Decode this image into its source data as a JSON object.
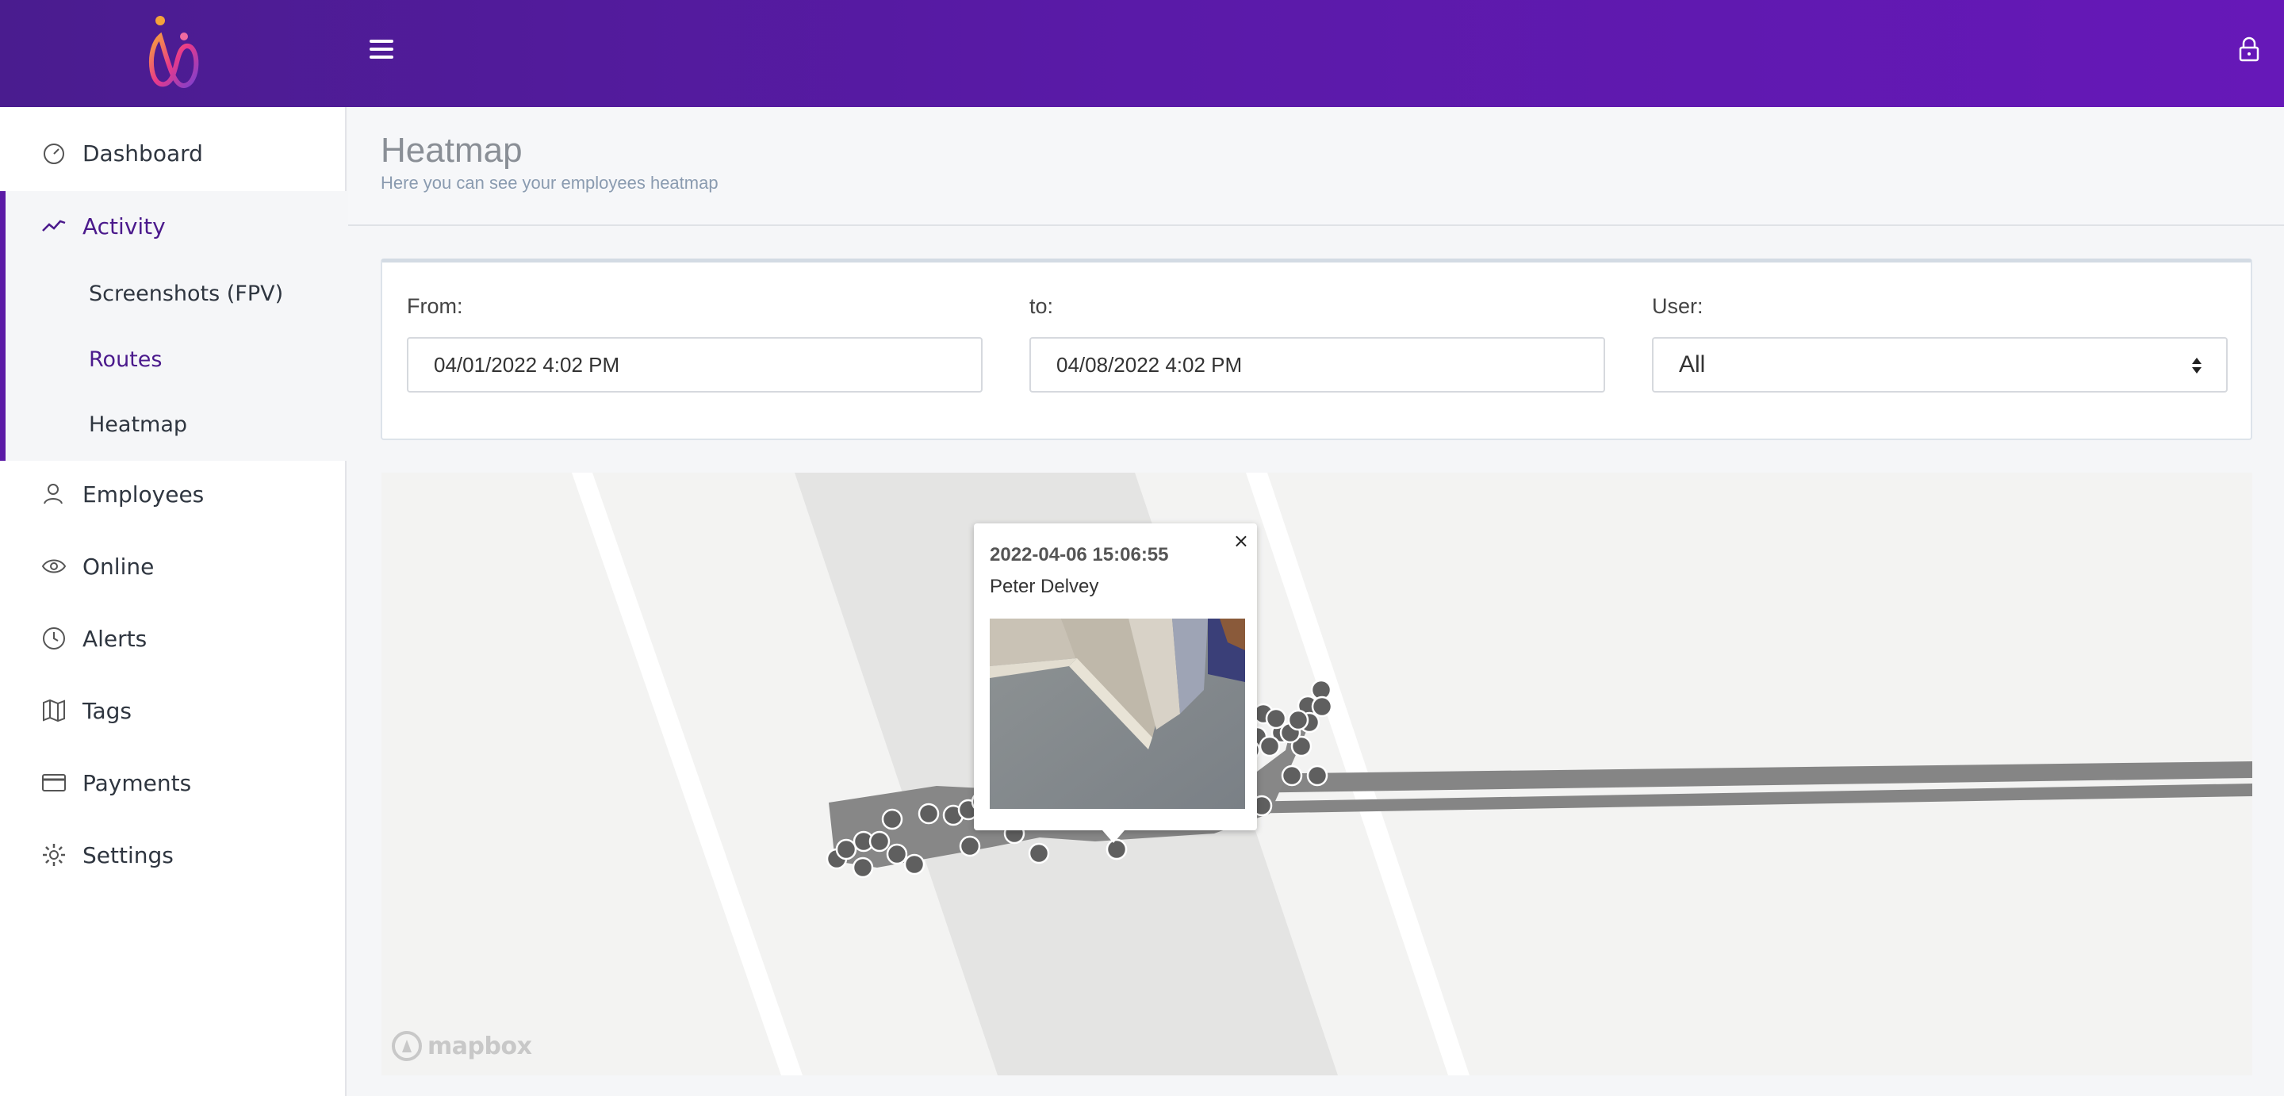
{
  "app": {
    "brand_color": "#5a1aa8",
    "accent_color": "#4b1a8c"
  },
  "sidebar": {
    "items": [
      {
        "label": "Dashboard",
        "icon": "gauge-icon"
      },
      {
        "label": "Activity",
        "icon": "activity-icon",
        "active": true
      },
      {
        "label": "Employees",
        "icon": "user-icon"
      },
      {
        "label": "Online",
        "icon": "eye-icon"
      },
      {
        "label": "Alerts",
        "icon": "clock-icon"
      },
      {
        "label": "Tags",
        "icon": "map-icon"
      },
      {
        "label": "Payments",
        "icon": "credit-card-icon"
      },
      {
        "label": "Settings",
        "icon": "gear-icon"
      }
    ],
    "activity_sub": [
      {
        "label": "Screenshots (FPV)"
      },
      {
        "label": "Routes",
        "active": true
      },
      {
        "label": "Heatmap"
      }
    ]
  },
  "page": {
    "title": "Heatmap",
    "subtitle": "Here you can see your employees heatmap"
  },
  "filters": {
    "from_label": "From:",
    "from_value": "04/01/2022 4:02 PM",
    "to_label": "to:",
    "to_value": "04/08/2022 4:02 PM",
    "user_label": "User:",
    "user_value": "All"
  },
  "map": {
    "popup": {
      "time": "2022-04-06 15:06:55",
      "user": "Peter Delvey",
      "close": "×"
    },
    "attribution": "mapbox"
  }
}
